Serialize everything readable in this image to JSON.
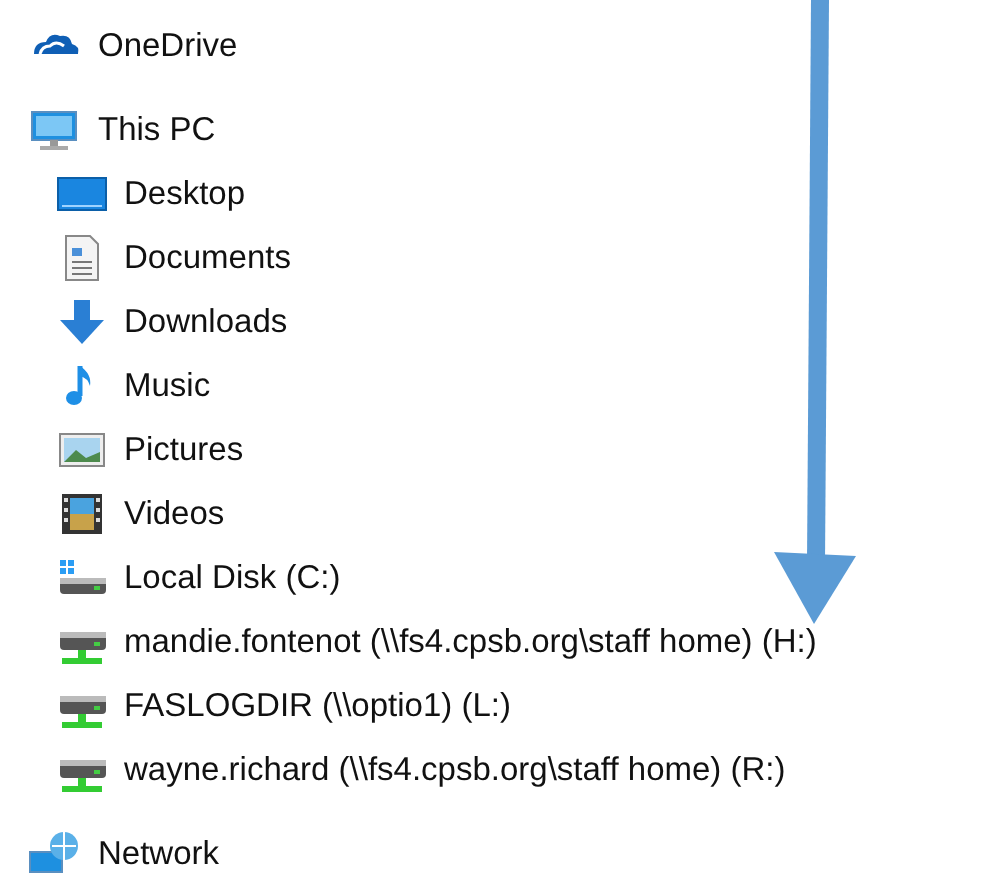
{
  "tree": [
    {
      "label": "OneDrive",
      "kind": "cloud"
    },
    {
      "label": "This PC",
      "kind": "computer",
      "children": [
        {
          "label": "Desktop",
          "kind": "desktop"
        },
        {
          "label": "Documents",
          "kind": "documents"
        },
        {
          "label": "Downloads",
          "kind": "downloads"
        },
        {
          "label": "Music",
          "kind": "music"
        },
        {
          "label": "Pictures",
          "kind": "pictures"
        },
        {
          "label": "Videos",
          "kind": "videos"
        },
        {
          "label": "Local Disk (C:)",
          "kind": "disk"
        },
        {
          "label": "mandie.fontenot (\\\\fs4.cpsb.org\\staff home) (H:)",
          "kind": "network-drive"
        },
        {
          "label": "FASLOGDIR (\\\\optio1) (L:)",
          "kind": "network-drive"
        },
        {
          "label": "wayne.richard (\\\\fs4.cpsb.org\\staff home) (R:)",
          "kind": "network-drive"
        }
      ]
    },
    {
      "label": "Network",
      "kind": "network"
    }
  ]
}
